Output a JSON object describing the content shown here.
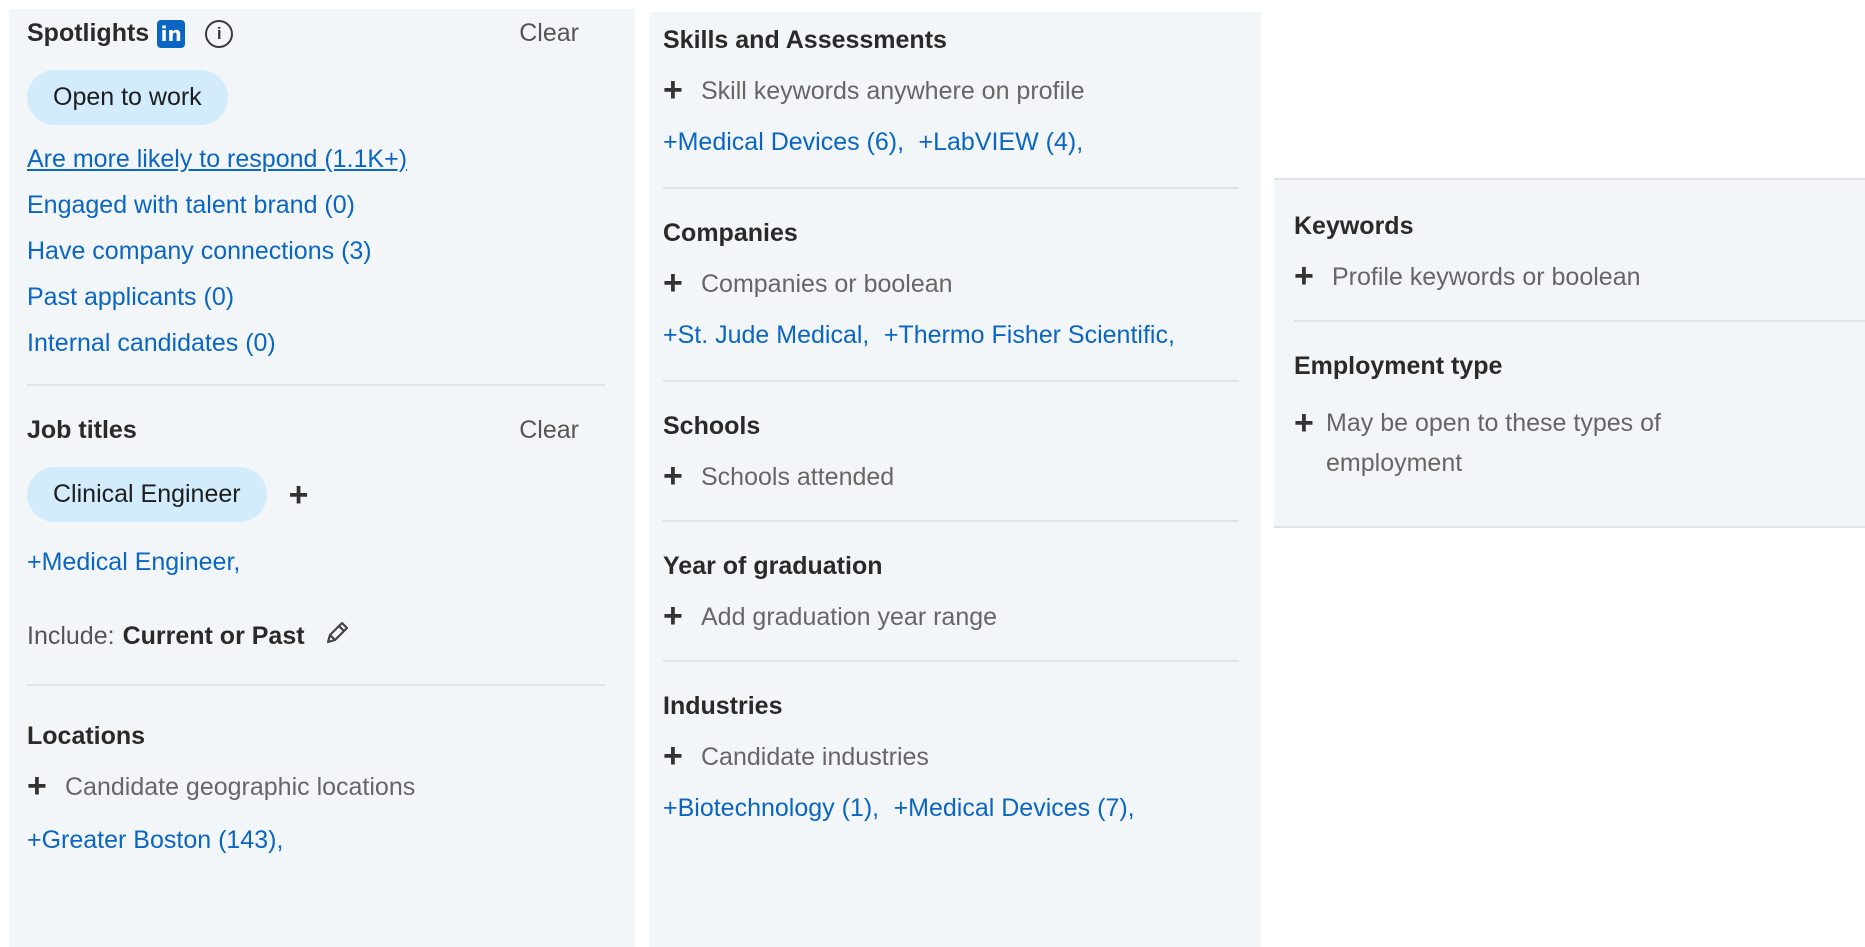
{
  "spotlights": {
    "title": "Spotlights",
    "clear_label": "Clear",
    "linkedin_icon": "in",
    "info_icon": "i",
    "active_chip": "Open to work",
    "items": [
      "Are more likely to respond (1.1K+)",
      "Engaged with talent brand (0)",
      "Have company connections (3)",
      "Past applicants (0)",
      "Internal candidates (0)"
    ]
  },
  "job_titles": {
    "title": "Job titles",
    "clear_label": "Clear",
    "chip": "Clinical Engineer",
    "add_symbol": "+",
    "suggestions": [
      "+Medical Engineer,"
    ],
    "include_label": "Include:",
    "include_value": "Current or Past"
  },
  "locations": {
    "title": "Locations",
    "placeholder": "Candidate geographic locations",
    "suggestions": [
      "+Greater Boston (143),"
    ]
  },
  "skills": {
    "title": "Skills and Assessments",
    "placeholder": "Skill keywords anywhere on profile",
    "suggestions": [
      "+Medical Devices (6),",
      "+LabVIEW (4),"
    ]
  },
  "companies": {
    "title": "Companies",
    "placeholder": "Companies or boolean",
    "suggestions": [
      "+St. Jude Medical,",
      "+Thermo Fisher Scientific,"
    ]
  },
  "schools": {
    "title": "Schools",
    "placeholder": "Schools attended"
  },
  "graduation": {
    "title": "Year of graduation",
    "placeholder": "Add graduation year range"
  },
  "industries": {
    "title": "Industries",
    "placeholder": "Candidate industries",
    "suggestions": [
      "+Biotechnology (1),",
      "+Medical Devices (7),"
    ]
  },
  "keywords": {
    "title": "Keywords",
    "placeholder": "Profile keywords or boolean"
  },
  "employment_type": {
    "title": "Employment type",
    "placeholder": "May be open to these types of employment"
  },
  "icons": {
    "plus": "+"
  },
  "colors": {
    "link": "#0a66c2",
    "chip_bg": "#d2ecfb",
    "panel_bg": "#f3f6f9"
  }
}
